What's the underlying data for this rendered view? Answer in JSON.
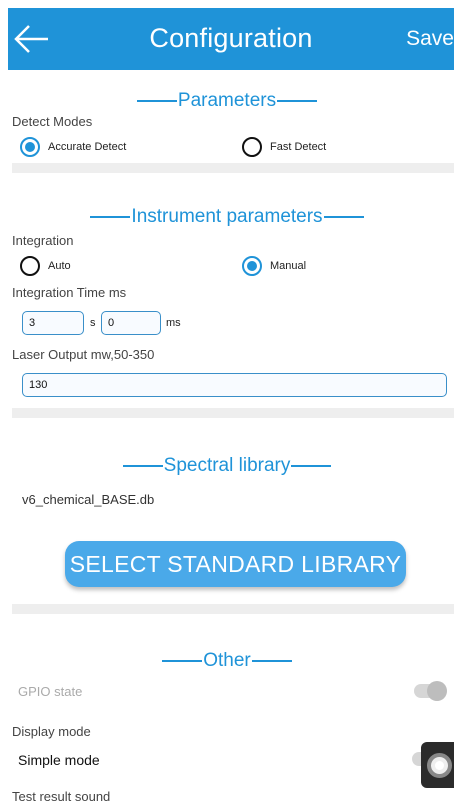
{
  "header": {
    "title": "Configuration",
    "save_label": "Save",
    "back_icon": "arrow-left-icon"
  },
  "parameters": {
    "title": "Parameters",
    "detect_modes_label": "Detect Modes",
    "options": [
      {
        "label": "Accurate Detect",
        "selected": true
      },
      {
        "label": "Fast Detect",
        "selected": false
      }
    ]
  },
  "instrument": {
    "title": "Instrument parameters",
    "integration_label": "Integration",
    "integration_options": [
      {
        "label": "Auto",
        "selected": false
      },
      {
        "label": "Manual",
        "selected": true
      }
    ],
    "integration_time_label": "Integration Time ms",
    "seconds_value": "3",
    "seconds_unit": "s",
    "ms_value": "0",
    "ms_unit": "ms",
    "laser_label": "Laser Output mw,50-350",
    "laser_value": "130"
  },
  "library": {
    "title": "Spectral library",
    "db_name": "v6_chemical_BASE.db",
    "select_button": "SELECT STANDARD LIBRARY"
  },
  "other": {
    "title": "Other",
    "gpio_label": "GPIO state",
    "gpio_enabled": false,
    "display_mode_label": "Display mode",
    "display_mode_value": "Simple mode",
    "test_result_sound_label": "Test result sound"
  },
  "colors": {
    "accent": "#1f93d8",
    "button": "#4aa9e9"
  }
}
